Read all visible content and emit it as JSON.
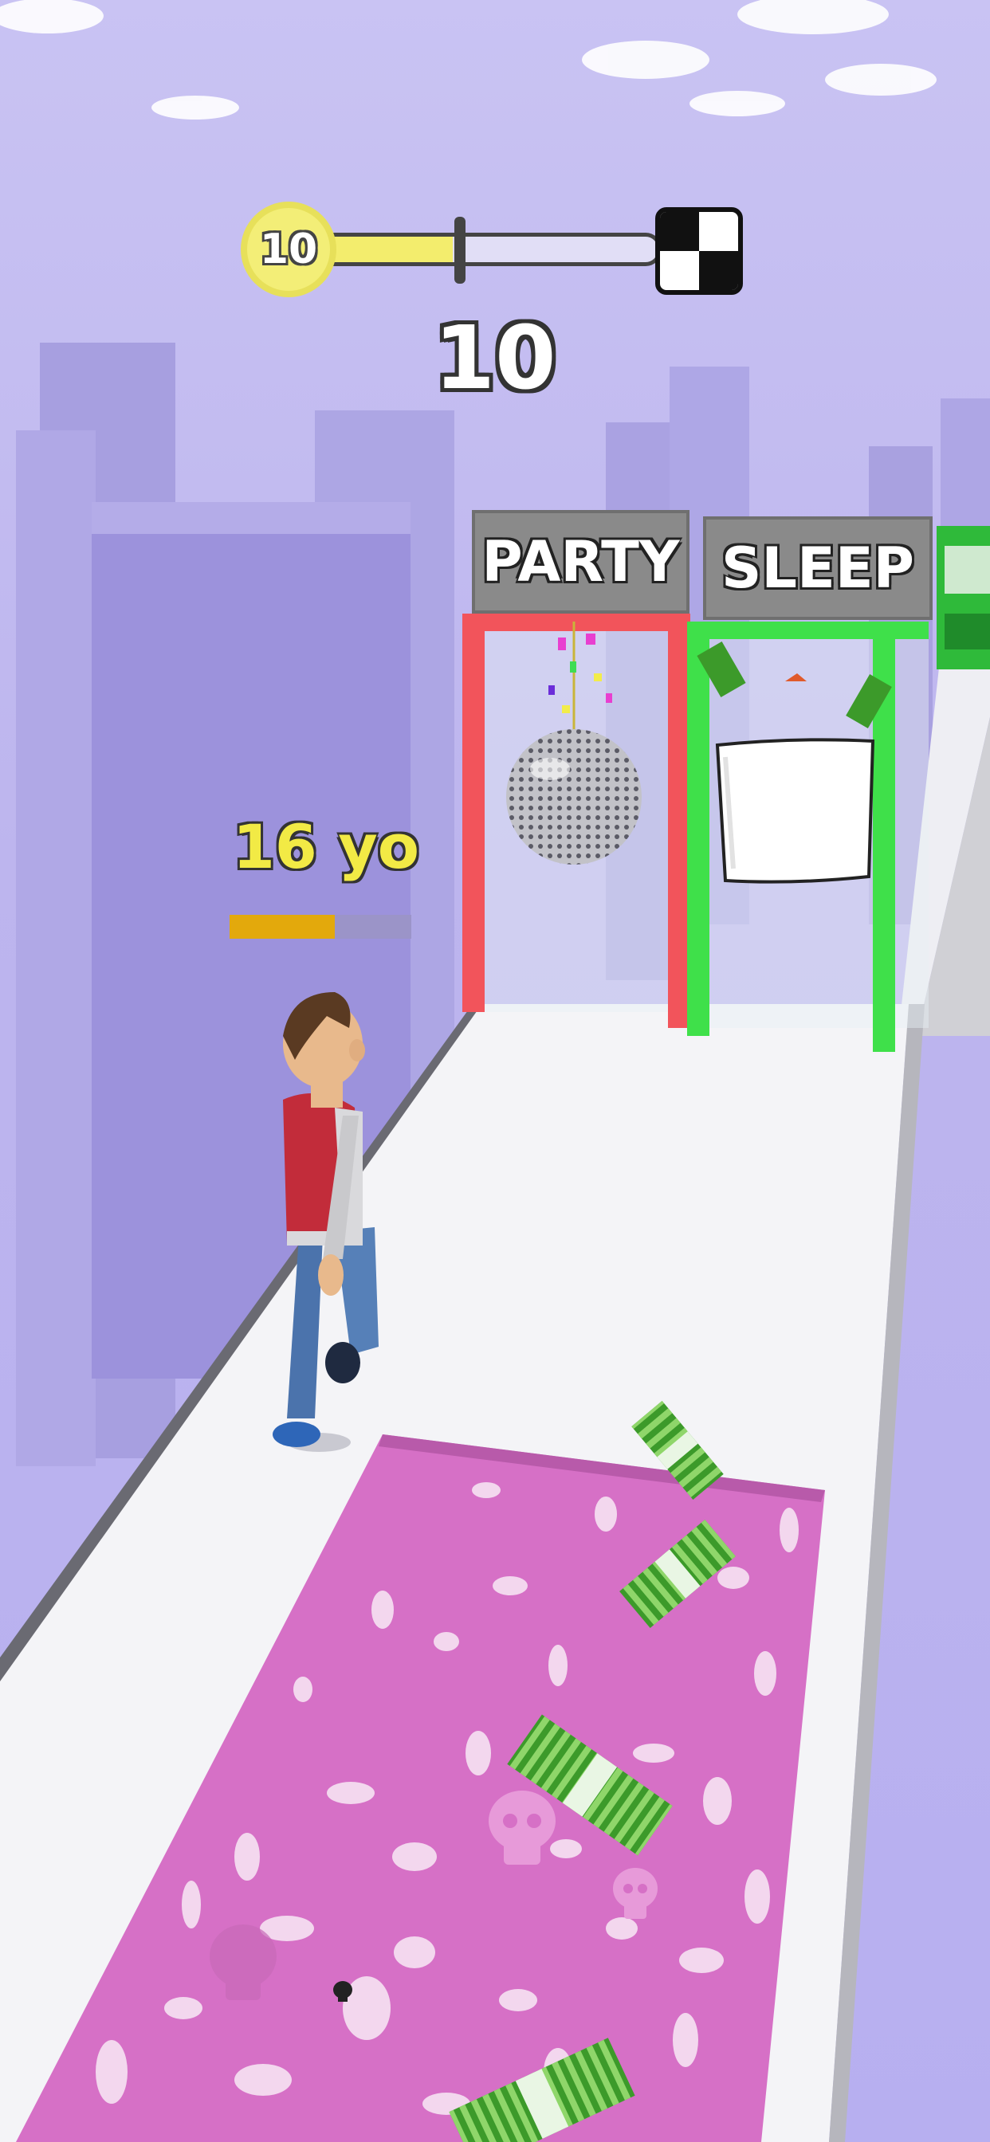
{
  "hud": {
    "current_level": "10",
    "level_progress": 0.38,
    "score": "10"
  },
  "player": {
    "age_label": "16 yo",
    "age_progress": 0.58
  },
  "gates": [
    {
      "label": "PARTY",
      "color": "#f2545b"
    },
    {
      "label": "SLEEP",
      "color": "#3fe04a"
    }
  ],
  "colors": {
    "sky": "#c5bff2",
    "road": "#f3f3f6",
    "slime": "#d96cc8",
    "cash": "#3c9a2a"
  },
  "icons": [
    "skull-icon",
    "disco-ball-icon",
    "pillow-icon",
    "cash-stack-icon",
    "checkered-flag-icon"
  ]
}
